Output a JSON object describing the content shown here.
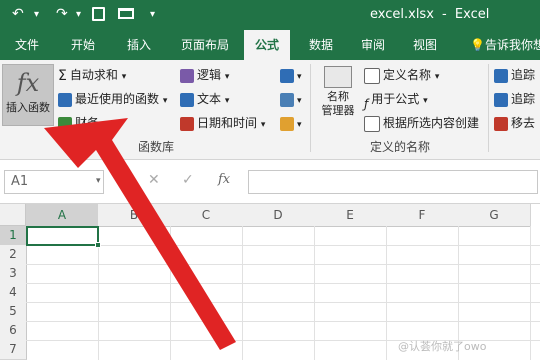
{
  "titlebar": {
    "filename": "excel.xlsx",
    "separator": "-",
    "app": "Excel"
  },
  "tabs": [
    "文件",
    "开始",
    "插入",
    "页面布局",
    "公式",
    "数据",
    "审阅",
    "视图"
  ],
  "tell_me": "告诉我你想",
  "ribbon": {
    "insert_function": {
      "glyph": "fx",
      "label": "插入函数"
    },
    "function_library": {
      "autosum": "自动求和",
      "recent": "最近使用的函数",
      "financial": "财务",
      "logical": "逻辑",
      "text": "文本",
      "datetime": "日期和时间",
      "label": "函数库"
    },
    "defined_names": {
      "name_manager": "名称\n管理器",
      "define_name": "定义名称",
      "use_in_formula": "用于公式",
      "create_from_selection": "根据所选内容创建",
      "label": "定义的名称"
    },
    "auditing": {
      "trace_precedents": "追踪",
      "trace_dependents": "追踪",
      "remove_arrows": "移去"
    }
  },
  "formula_bar": {
    "name_box": "A1",
    "cancel": "✕",
    "enter": "✓",
    "fx": "fx",
    "value": ""
  },
  "grid": {
    "columns": [
      "A",
      "B",
      "C",
      "D",
      "E",
      "F",
      "G"
    ],
    "rows": [
      "1",
      "2",
      "3",
      "4",
      "5",
      "6",
      "7"
    ],
    "selected_cell": "A1"
  },
  "watermark": "@认荟你就了owo",
  "colors": {
    "brand": "#217346",
    "arrow": "#e02424"
  }
}
